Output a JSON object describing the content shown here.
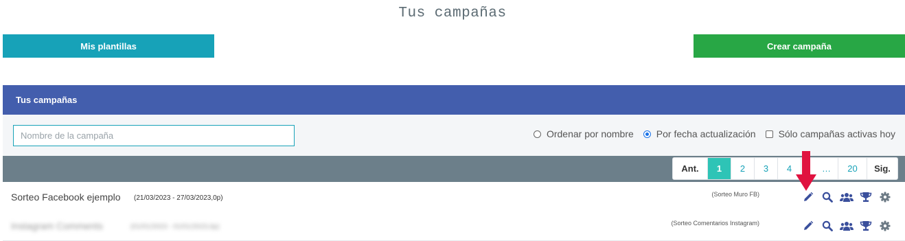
{
  "page": {
    "title": "Tus campañas"
  },
  "buttons": {
    "templates": "Mis plantillas",
    "create": "Crear campaña"
  },
  "panel": {
    "title": "Tus campañas"
  },
  "filter": {
    "search_placeholder": "Nombre de la campaña",
    "sort_by_name": "Ordenar por nombre",
    "sort_by_date": "Por fecha actualización",
    "active_only": "Sólo campañas activas hoy"
  },
  "pagination": {
    "prev": "Ant.",
    "pages": [
      "1",
      "2",
      "3",
      "4",
      "…",
      "20"
    ],
    "next": "Sig.",
    "current": "1"
  },
  "campaigns": [
    {
      "name": "Sorteo Facebook ejemplo",
      "dates": "(21/03/2023 - 27/03/2023,0p)",
      "type": "(Sorteo Muro FB)"
    },
    {
      "name": "Instagram Comments",
      "dates": "(01/01/2023 - 01/01/2023,0p)",
      "type": "(Sorteo Comentarios Instagram)"
    }
  ],
  "colors": {
    "templates_button": "#17a2b8",
    "create_button": "#28a745",
    "panel_header": "#435ead",
    "pager_bar": "#6c7f8a",
    "active_page": "#2ec4b6",
    "action_icons": "#3a4f9c",
    "settings_icon": "#6c7a85",
    "annotation_arrow": "#e0123f"
  },
  "icons": [
    "pencil-icon",
    "search-icon",
    "users-icon",
    "trophy-icon",
    "gear-icon"
  ]
}
